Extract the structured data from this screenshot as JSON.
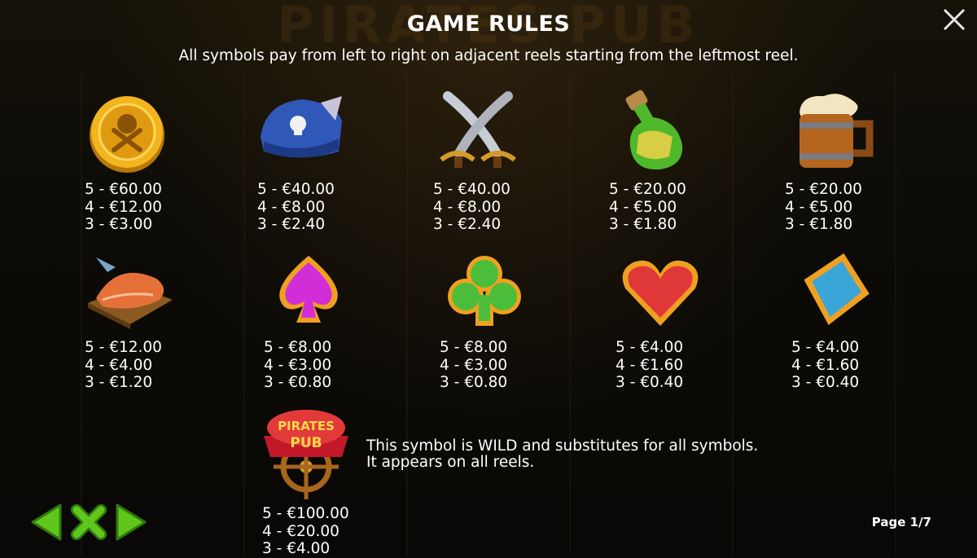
{
  "title": "GAME RULES",
  "subtitle": "All symbols pay from left to right on adjacent reels starting from the leftmost reel.",
  "background_text": "PIRATES PUB",
  "symbols": [
    {
      "name": "gold-coin",
      "pays": [
        "5 - €60.00",
        "4 - €12.00",
        "3 - €3.00"
      ]
    },
    {
      "name": "pirate-hat",
      "pays": [
        "5 - €40.00",
        "4 - €8.00",
        "3 - €2.40"
      ]
    },
    {
      "name": "crossed-swords",
      "pays": [
        "5 - €40.00",
        "4 - €8.00",
        "3 - €2.40"
      ]
    },
    {
      "name": "rum-bottle",
      "pays": [
        "5 - €20.00",
        "4 - €5.00",
        "3 - €1.80"
      ]
    },
    {
      "name": "beer-mug",
      "pays": [
        "5 - €20.00",
        "4 - €5.00",
        "3 - €1.80"
      ]
    },
    {
      "name": "fish-steak",
      "pays": [
        "5 - €12.00",
        "4 - €4.00",
        "3 - €1.20"
      ]
    },
    {
      "name": "spade",
      "pays": [
        "5 - €8.00",
        "4 - €3.00",
        "3 - €0.80"
      ]
    },
    {
      "name": "club",
      "pays": [
        "5 - €8.00",
        "4 - €3.00",
        "3 - €0.80"
      ]
    },
    {
      "name": "heart",
      "pays": [
        "5 - €4.00",
        "4 - €1.60",
        "3 - €0.40"
      ]
    },
    {
      "name": "diamond",
      "pays": [
        "5 - €4.00",
        "4 - €1.60",
        "3 - €0.40"
      ]
    }
  ],
  "wild": {
    "logo_line1": "PIRATES",
    "logo_line2": "PUB",
    "description_line1": "This symbol is WILD and substitutes for all symbols.",
    "description_line2": "It appears on all reels.",
    "pays": [
      "5 - €100.00",
      "4 - €20.00",
      "3 - €4.00"
    ]
  },
  "page_indicator": "Page 1/7",
  "colors": {
    "nav_green": "#5fc61e",
    "background": "#0b0a08",
    "text": "#ffffff"
  }
}
